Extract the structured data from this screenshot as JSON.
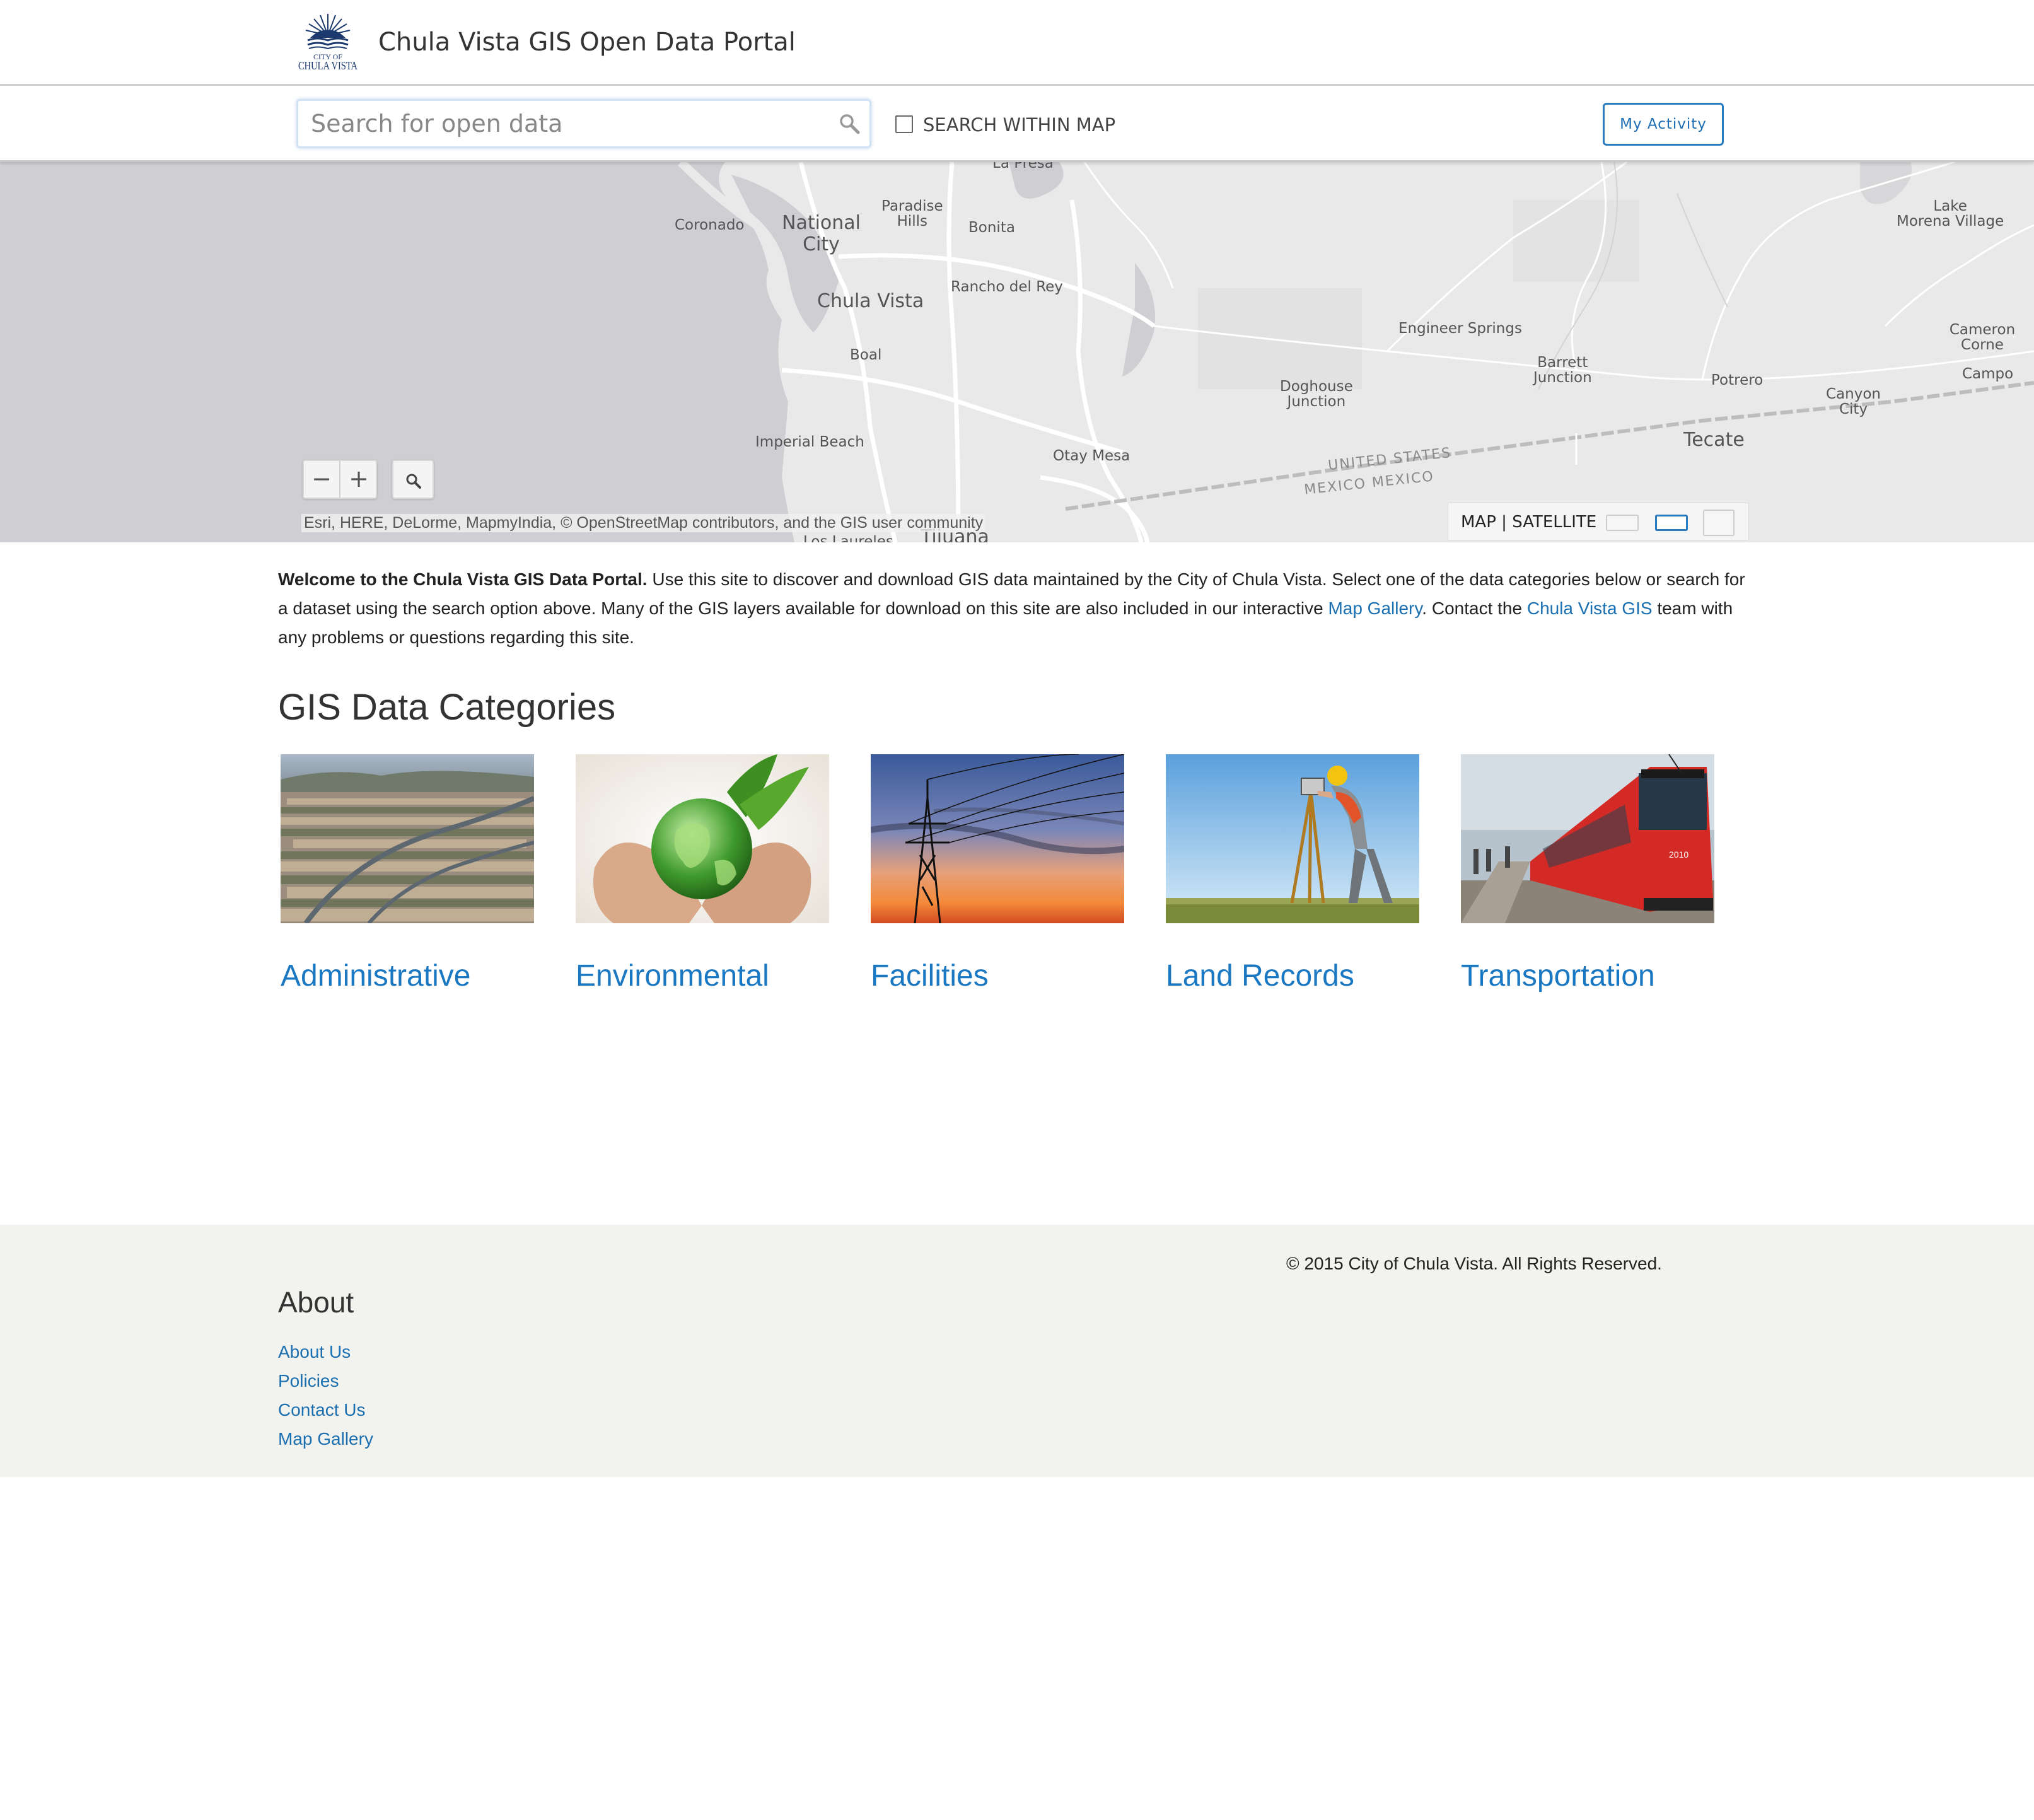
{
  "header": {
    "logo_text": "CITY OF CHULA VISTA",
    "title": "Chula Vista GIS Open Data Portal"
  },
  "search": {
    "placeholder": "Search for open data",
    "within_map_label": "SEARCH WITHIN MAP",
    "within_map_checked": false,
    "activity_button": "My Activity"
  },
  "map": {
    "labels": {
      "coronado": "Coronado",
      "national_city": "National\nCity",
      "paradise_hills": "Paradise\nHills",
      "bonita": "Bonita",
      "chula_vista": "Chula Vista",
      "rancho_del_rey": "Rancho del Rey",
      "boal": "Boal",
      "imperial_beach": "Imperial Beach",
      "otay_mesa": "Otay Mesa",
      "engineer_springs": "Engineer Springs",
      "barrett_junction": "Barrett\nJunction",
      "doghouse_junction": "Doghouse\nJunction",
      "potrero": "Potrero",
      "canyon_city": "Canyon\nCity",
      "tecate": "Tecate",
      "lake_morena_village": "Lake\nMorena Village",
      "cameron_corners": "Cameron Corne",
      "campo": "Campo",
      "united_states": "UNITED STATES",
      "mexico": "MEXICO MEXICO",
      "la_presa": "La Presa",
      "tijuana": "Tijuana",
      "los_laureles": "Los Laureles"
    },
    "zoom_out": "−",
    "zoom_in": "+",
    "attribution": "Esri, HERE, DeLorme, MapmyIndia, © OpenStreetMap contributors, and the GIS user community",
    "basemap_map": "MAP",
    "basemap_separator": "|",
    "basemap_satellite": "SATELLITE"
  },
  "intro": {
    "bold_lead": "Welcome to the Chula Vista GIS Data Portal.",
    "text_1": "  Use this site to discover and download GIS data maintained by the City of Chula Vista.  Select one of the data categories below or search for a dataset using the search option above.  Many of the GIS layers available for download on this site are also included in our interactive ",
    "link_map_gallery": "Map Gallery",
    "text_2": ".  Contact the ",
    "link_cv_gis": "Chula Vista GIS",
    "text_3": " team with any problems or questions regarding this site."
  },
  "categories": {
    "heading": "GIS Data Categories",
    "items": [
      {
        "label": "Administrative",
        "image": "aerial-neighborhood-photo"
      },
      {
        "label": "Environmental",
        "image": "hands-holding-globe-photo"
      },
      {
        "label": "Facilities",
        "image": "power-lines-sunset-photo"
      },
      {
        "label": "Land Records",
        "image": "surveyor-photo"
      },
      {
        "label": "Transportation",
        "image": "red-trolley-photo"
      }
    ]
  },
  "footer": {
    "about_heading": "About",
    "links": [
      "About Us",
      "Policies",
      "Contact Us",
      "Map Gallery"
    ],
    "copyright": "© 2015 City of Chula Vista. All Rights Reserved."
  },
  "colors": {
    "link": "#1a6fb0",
    "category_link": "#1a78c2",
    "footer_bg": "#f2f2ef",
    "ocean": "#cfcfd3",
    "land": "#e9e9e9"
  }
}
